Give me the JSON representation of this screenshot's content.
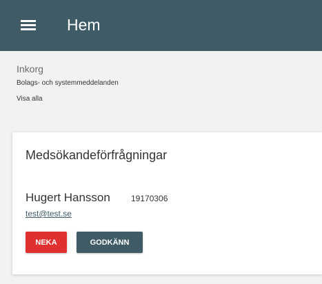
{
  "appbar": {
    "title": "Hem",
    "menu_icon": "hamburger-menu-icon",
    "color": "#3f5b66"
  },
  "inbox": {
    "label": "Inkorg",
    "subtitle": "Bolags- och systemmeddelanden",
    "view_all_link": "Visa alla"
  },
  "card": {
    "title": "Medsökandeförfrågningar",
    "request": {
      "name": "Hugert Hansson",
      "id_number": "19170306",
      "email": "test@test.se"
    },
    "deny_label": "NEKA",
    "approve_label": "GODKÄNN",
    "deny_color": "#e03131",
    "approve_color": "#3f5b66"
  }
}
